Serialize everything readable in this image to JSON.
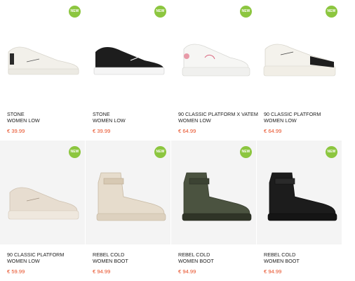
{
  "products": [
    {
      "line1": "STONE",
      "line2": "WOMEN LOW",
      "price": "€ 39.99",
      "badge": "NEW"
    },
    {
      "line1": "STONE",
      "line2": "WOMEN LOW",
      "price": "€ 39.99",
      "badge": "NEW"
    },
    {
      "line1": "90 CLASSIC PLATFORM X VATEM",
      "line2": "WOMEN LOW",
      "price": "€ 64.99",
      "badge": "NEW"
    },
    {
      "line1": "90 CLASSIC PLATFORM",
      "line2": "WOMEN LOW",
      "price": "€ 64.99",
      "badge": "NEW"
    },
    {
      "line1": "90 CLASSIC PLATFORM",
      "line2": "WOMEN LOW",
      "price": "€ 59.99",
      "badge": "NEW"
    },
    {
      "line1": "REBEL COLD",
      "line2": "WOMEN BOOT",
      "price": "€ 94.99",
      "badge": "NEW"
    },
    {
      "line1": "REBEL COLD",
      "line2": "WOMEN BOOT",
      "price": "€ 94.99",
      "badge": "NEW"
    },
    {
      "line1": "REBEL COLD",
      "line2": "WOMEN BOOT",
      "price": "€ 94.99",
      "badge": "NEW"
    }
  ],
  "colors": {
    "badge": "#8cc63f",
    "price": "#e74c24",
    "text": "#222222"
  }
}
